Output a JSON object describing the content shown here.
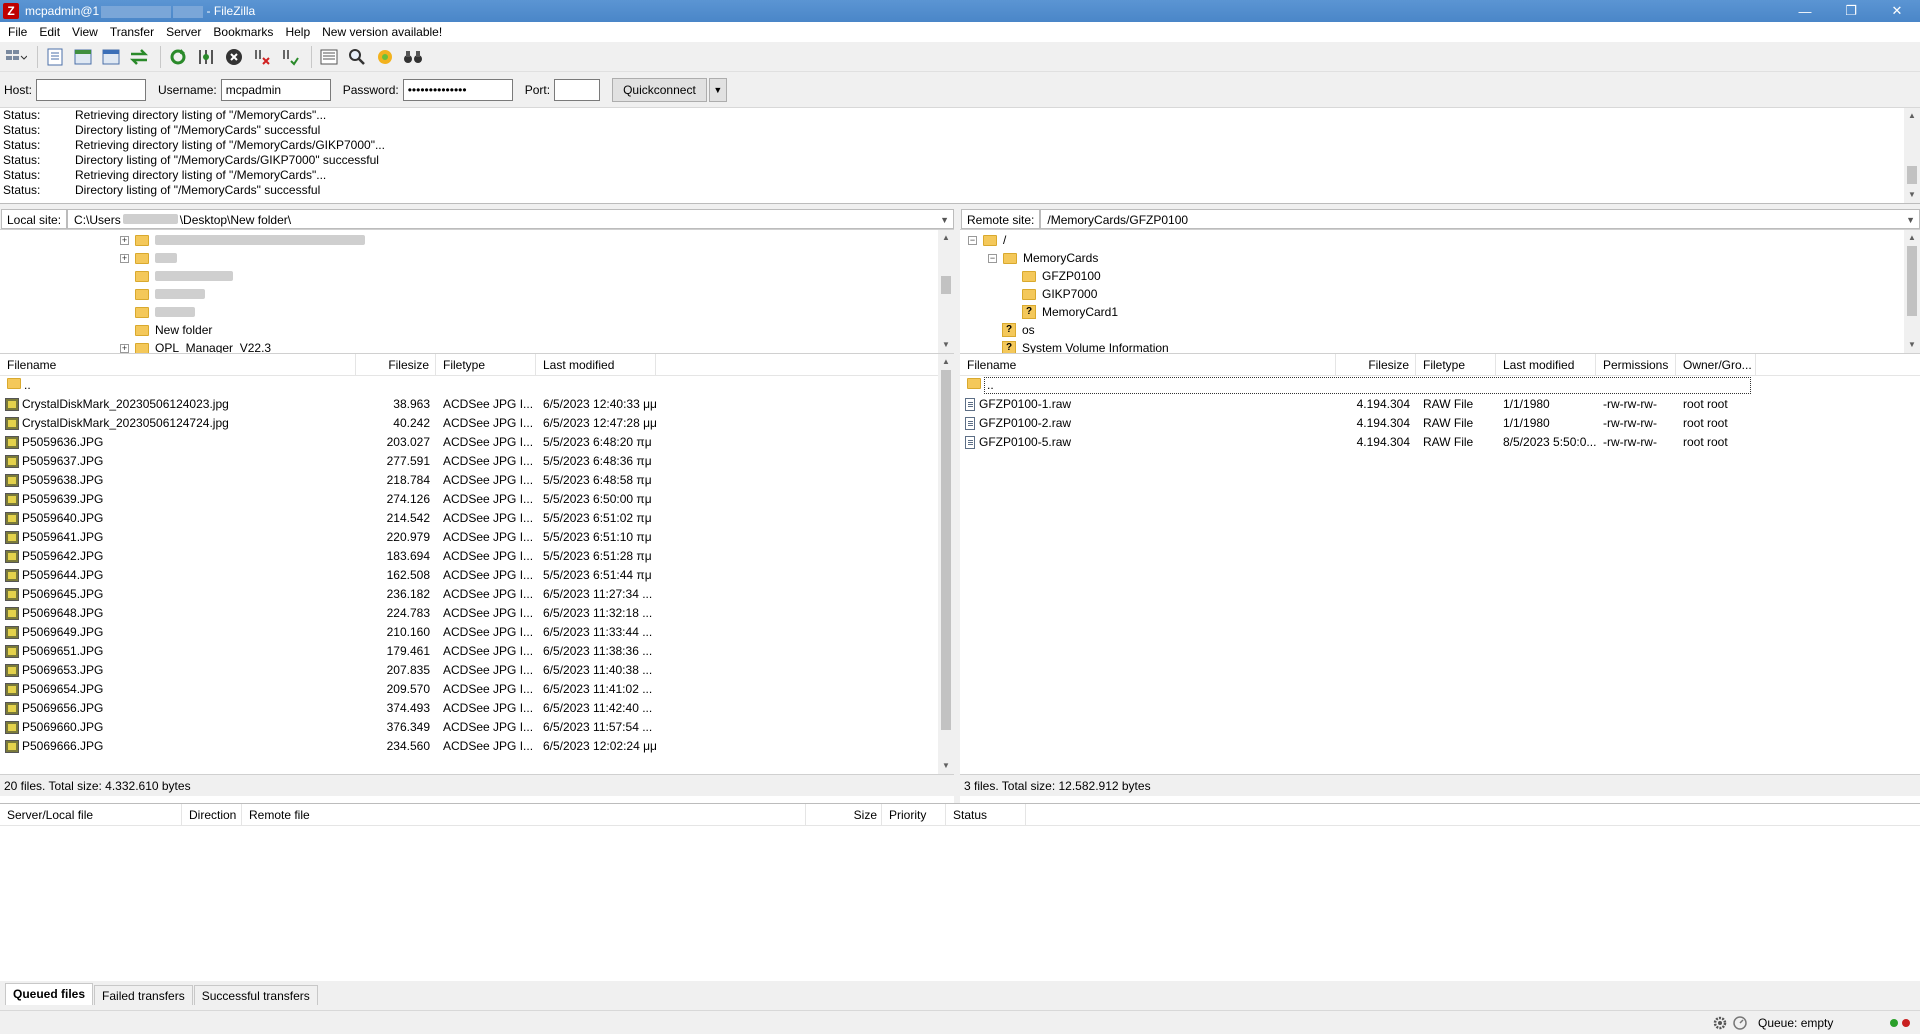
{
  "window": {
    "title_prefix": "mcpadmin@1",
    "title_suffix": " - FileZilla",
    "minimize": "—",
    "restore": "❐",
    "close": "✕"
  },
  "menu": [
    "File",
    "Edit",
    "View",
    "Transfer",
    "Server",
    "Bookmarks",
    "Help",
    "New version available!"
  ],
  "quickconnect": {
    "host_label": "Host:",
    "host_value": "",
    "username_label": "Username:",
    "username_value": "mcpadmin",
    "password_label": "Password:",
    "password_value": "••••••••••••••",
    "port_label": "Port:",
    "port_value": "",
    "button": "Quickconnect"
  },
  "log": [
    {
      "k": "Status:",
      "v": "Retrieving directory listing of \"/MemoryCards\"..."
    },
    {
      "k": "Status:",
      "v": "Directory listing of \"/MemoryCards\" successful"
    },
    {
      "k": "Status:",
      "v": "Retrieving directory listing of \"/MemoryCards/GIKP7000\"..."
    },
    {
      "k": "Status:",
      "v": "Directory listing of \"/MemoryCards/GIKP7000\" successful"
    },
    {
      "k": "Status:",
      "v": "Retrieving directory listing of \"/MemoryCards\"..."
    },
    {
      "k": "Status:",
      "v": "Directory listing of \"/MemoryCards\" successful"
    }
  ],
  "local": {
    "site_label": "Local site:",
    "path_start": "C:\\Users",
    "path_end": "\\Desktop\\New folder\\",
    "tree": [
      "New folder",
      "OPL_Manager_V22.3"
    ],
    "columns": [
      "Filename",
      "Filesize",
      "Filetype",
      "Last modified"
    ],
    "parent": "..",
    "files": [
      [
        "CrystalDiskMark_20230506124023.jpg",
        "38.963",
        "ACDSee JPG I...",
        "6/5/2023 12:40:33 μμ"
      ],
      [
        "CrystalDiskMark_20230506124724.jpg",
        "40.242",
        "ACDSee JPG I...",
        "6/5/2023 12:47:28 μμ"
      ],
      [
        "P5059636.JPG",
        "203.027",
        "ACDSee JPG I...",
        "5/5/2023 6:48:20 πμ"
      ],
      [
        "P5059637.JPG",
        "277.591",
        "ACDSee JPG I...",
        "5/5/2023 6:48:36 πμ"
      ],
      [
        "P5059638.JPG",
        "218.784",
        "ACDSee JPG I...",
        "5/5/2023 6:48:58 πμ"
      ],
      [
        "P5059639.JPG",
        "274.126",
        "ACDSee JPG I...",
        "5/5/2023 6:50:00 πμ"
      ],
      [
        "P5059640.JPG",
        "214.542",
        "ACDSee JPG I...",
        "5/5/2023 6:51:02 πμ"
      ],
      [
        "P5059641.JPG",
        "220.979",
        "ACDSee JPG I...",
        "5/5/2023 6:51:10 πμ"
      ],
      [
        "P5059642.JPG",
        "183.694",
        "ACDSee JPG I...",
        "5/5/2023 6:51:28 πμ"
      ],
      [
        "P5059644.JPG",
        "162.508",
        "ACDSee JPG I...",
        "5/5/2023 6:51:44 πμ"
      ],
      [
        "P5069645.JPG",
        "236.182",
        "ACDSee JPG I...",
        "6/5/2023 11:27:34 ..."
      ],
      [
        "P5069648.JPG",
        "224.783",
        "ACDSee JPG I...",
        "6/5/2023 11:32:18 ..."
      ],
      [
        "P5069649.JPG",
        "210.160",
        "ACDSee JPG I...",
        "6/5/2023 11:33:44 ..."
      ],
      [
        "P5069651.JPG",
        "179.461",
        "ACDSee JPG I...",
        "6/5/2023 11:38:36 ..."
      ],
      [
        "P5069653.JPG",
        "207.835",
        "ACDSee JPG I...",
        "6/5/2023 11:40:38 ..."
      ],
      [
        "P5069654.JPG",
        "209.570",
        "ACDSee JPG I...",
        "6/5/2023 11:41:02 ..."
      ],
      [
        "P5069656.JPG",
        "374.493",
        "ACDSee JPG I...",
        "6/5/2023 11:42:40 ..."
      ],
      [
        "P5069660.JPG",
        "376.349",
        "ACDSee JPG I...",
        "6/5/2023 11:57:54 ..."
      ],
      [
        "P5069666.JPG",
        "234.560",
        "ACDSee JPG I...",
        "6/5/2023 12:02:24 μμ"
      ]
    ],
    "summary": "20 files. Total size: 4.332.610 bytes"
  },
  "remote": {
    "site_label": "Remote site:",
    "path": "/MemoryCards/GFZP0100",
    "tree": [
      "/",
      "MemoryCards",
      "GFZP0100",
      "GIKP7000",
      "MemoryCard1",
      "os",
      "System Volume Information"
    ],
    "columns": [
      "Filename",
      "Filesize",
      "Filetype",
      "Last modified",
      "Permissions",
      "Owner/Gro..."
    ],
    "parent": "..",
    "files": [
      [
        "GFZP0100-1.raw",
        "4.194.304",
        "RAW File",
        "1/1/1980",
        "-rw-rw-rw-",
        "root root"
      ],
      [
        "GFZP0100-2.raw",
        "4.194.304",
        "RAW File",
        "1/1/1980",
        "-rw-rw-rw-",
        "root root"
      ],
      [
        "GFZP0100-5.raw",
        "4.194.304",
        "RAW File",
        "8/5/2023 5:50:0...",
        "-rw-rw-rw-",
        "root root"
      ]
    ],
    "summary": "3 files. Total size: 12.582.912 bytes"
  },
  "queue": {
    "columns": [
      "Server/Local file",
      "Direction",
      "Remote file",
      "Size",
      "Priority",
      "Status"
    ],
    "tabs": [
      "Queued files",
      "Failed transfers",
      "Successful transfers"
    ]
  },
  "statusbar": {
    "queue": "Queue: empty"
  }
}
